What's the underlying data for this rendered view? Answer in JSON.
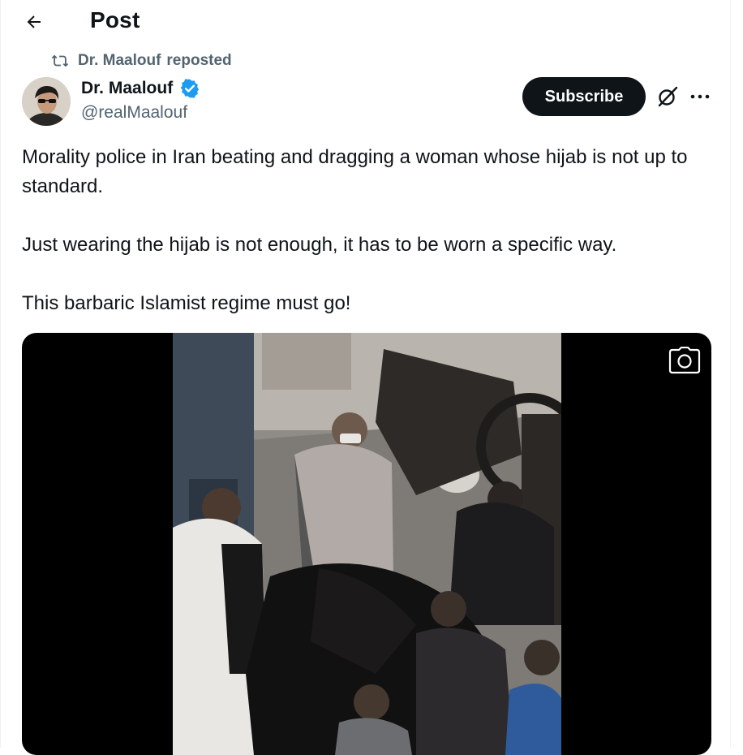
{
  "header": {
    "title": "Post"
  },
  "repost": {
    "user": "Dr. Maalouf",
    "action": "reposted"
  },
  "author": {
    "name": "Dr. Maalouf",
    "handle": "@realMaalouf",
    "verified": true
  },
  "actions": {
    "subscribe_label": "Subscribe"
  },
  "tweet": {
    "paragraphs": [
      "Morality police in Iran beating and dragging a woman whose hijab is not up to standard.",
      "Just wearing the hijab is not enough, it has to be worn a specific way.",
      "This barbaric Islamist regime must go!"
    ]
  },
  "icons": {
    "back": "arrow-left-icon",
    "repost": "repost-icon",
    "verified": "verified-badge-icon",
    "grok": "grok-icon",
    "more": "more-dots-icon",
    "camera": "camera-icon"
  },
  "colors": {
    "text": "#0f1419",
    "secondary": "#536471",
    "verified": "#1d9bf0",
    "button_bg": "#0f1419",
    "media_bg": "#000000"
  }
}
